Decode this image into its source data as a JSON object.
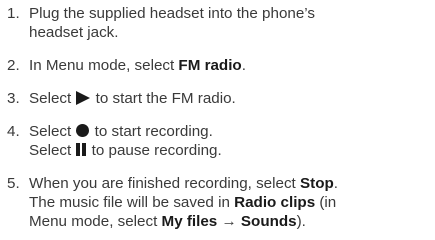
{
  "steps": [
    {
      "num": "1.",
      "lines": [
        {
          "a": "Plug the supplied headset into the phone’s"
        },
        {
          "a": "headset jack."
        }
      ]
    },
    {
      "num": "2.",
      "a": "In Menu mode, select ",
      "b": "FM radio",
      "c": "."
    },
    {
      "num": "3.",
      "a": "Select ",
      "icon": "play-icon",
      "c": " to start the FM radio."
    },
    {
      "num": "4.",
      "lines": [
        {
          "a": "Select ",
          "icon": "record-icon",
          "c": " to start recording."
        },
        {
          "a": "Select ",
          "icon": "pause-icon",
          "c": " to pause recording."
        }
      ]
    },
    {
      "num": "5.",
      "lines": [
        {
          "a": "When you are finished recording, select ",
          "b": "Stop",
          "c": "."
        },
        {
          "a": "The music file will be saved in ",
          "b": "Radio clips",
          "c": " (in"
        },
        {
          "a": "Menu mode, select ",
          "b": "My files",
          "c": " → ",
          "d": "Sounds",
          "e": ")."
        }
      ]
    }
  ]
}
